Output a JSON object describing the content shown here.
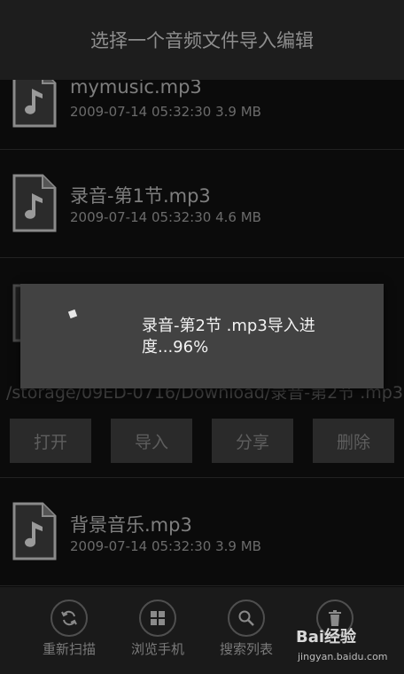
{
  "header": {
    "title": "选择一个音频文件导入编辑"
  },
  "files": [
    {
      "name": "mymusic.mp3",
      "meta": "2009-07-14 05:32:30  3.9 MB"
    },
    {
      "name": "录音-第1节.mp3",
      "meta": "2009-07-14 05:32:30  4.6 MB"
    },
    {
      "path": "/storage/09ED-0716/Download/录音-第2节 .mp3"
    },
    {
      "name": "背景音乐.mp3",
      "meta": "2009-07-14 05:32:30  3.9 MB"
    }
  ],
  "actions": {
    "open": "打开",
    "import": "导入",
    "share": "分享",
    "delete": "删除"
  },
  "dialog": {
    "message": "录音-第2节 .mp3导入进度...96%",
    "progress_percent": 96
  },
  "bottom_nav": [
    {
      "label": "重新扫描",
      "icon": "refresh-icon"
    },
    {
      "label": "浏览手机",
      "icon": "grid-icon"
    },
    {
      "label": "搜索列表",
      "icon": "search-icon"
    },
    {
      "label": "",
      "icon": "trash-icon"
    }
  ],
  "watermark": {
    "logo": "Bai经验",
    "url": "jingyan.baidu.com"
  }
}
